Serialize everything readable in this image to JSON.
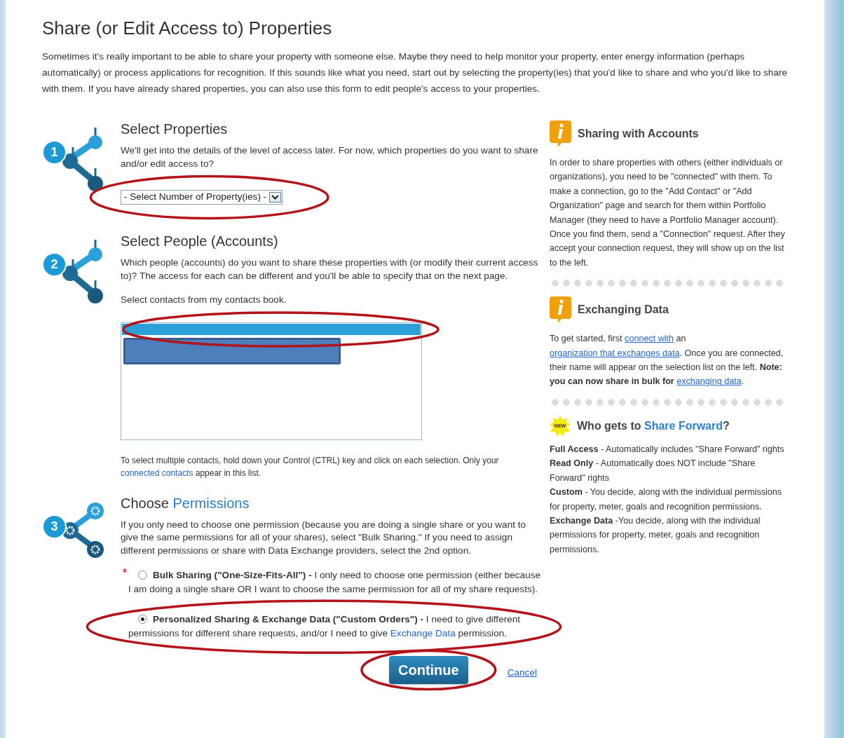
{
  "title": "Share (or Edit Access to) Properties",
  "intro": "Sometimes it's really important to be able to share your property with someone else. Maybe they need to help monitor your property, enter energy information (perhaps automatically) or process applications for recognition. If this sounds like what you need, start out by selecting the property(ies) that you'd like to share and who you'd like to share with them. If you have already shared properties, you can also use this form to edit people's access to your properties.",
  "steps": [
    {
      "kind": "dropdown",
      "number": "1",
      "title": [
        {
          "text": "Select Properties",
          "kind": "text"
        }
      ],
      "description": "We'll get into the details of the level of access later. For now, which properties do you want to share and/or edit access to?",
      "dropdown": {
        "value": "- Select Number of Property(ies) -",
        "circled": true
      }
    },
    {
      "kind": "list",
      "number": "2",
      "title": [
        {
          "text": "Select People (Accounts)",
          "kind": "text"
        }
      ],
      "description": "Which people (accounts) do you want to share these properties with (or modify their current access to)? The access for each can be different and you'll be able to specify that on the next page.",
      "list_label": "Select contacts from my contacts book.",
      "rows": [
        {
          "selected": true,
          "redacted": false,
          "circled": true
        },
        {
          "selected": false,
          "redacted": true,
          "circled": false
        }
      ],
      "note": [
        {
          "text": "To select multiple contacts, hold down your Control (CTRL) key and click on each selection. Only your ",
          "kind": "text"
        },
        {
          "text": "connected contacts",
          "kind": "link"
        },
        {
          "text": " appear in this list.",
          "kind": "text"
        }
      ]
    },
    {
      "kind": "options",
      "number": "3",
      "title": [
        {
          "text": "Choose ",
          "kind": "text"
        },
        {
          "text": "Permissions",
          "kind": "accent"
        }
      ],
      "description": "If you only need to choose one permission (because you are doing a single share or you want to give the same permissions for all of your shares), select \"Bulk Sharing.\" If you need to assign different permissions or share with Data Exchange providers, select the 2nd option.",
      "options": [
        {
          "selected": false,
          "required": true,
          "circled": false,
          "text": [
            {
              "text": "Bulk Sharing (\"One-Size-Fits-All\") -",
              "kind": "bold"
            },
            {
              "text": " I only need to choose one permission (either because I am doing a single share OR I want to choose the same permission for all of my share requests).",
              "kind": "text"
            }
          ]
        },
        {
          "selected": true,
          "required": false,
          "circled": true,
          "text": [
            {
              "text": "Personalized Sharing & Exchange Data (\"Custom Orders\") -",
              "kind": "bold"
            },
            {
              "text": " I need to give different permissions for different share requests, and/or I need to give ",
              "kind": "text"
            },
            {
              "text": "Exchange Data",
              "kind": "link"
            },
            {
              "text": " permission.",
              "kind": "text"
            }
          ]
        }
      ]
    }
  ],
  "actions": {
    "continue": {
      "label": "Continue",
      "circled": true
    },
    "cancel": "Cancel"
  },
  "sidebar": [
    {
      "kind": "info",
      "title": [
        {
          "text": "Sharing with Accounts",
          "kind": "text"
        }
      ],
      "paragraphs": [
        [
          {
            "text": "In order to share properties with others (either individuals or organizations), you need to be \"connected\" with them. To make a connection, go to the \"Add Contact\" or \"Add Organization\" page and search for them within Portfolio Manager (they need to have a Portfolio Manager account). Once you find them, send a \"Connection\" request. After they accept your connection request, they will show up on the list to the left.",
            "kind": "text"
          }
        ]
      ]
    },
    {
      "kind": "info",
      "title": [
        {
          "text": "Exchanging Data",
          "kind": "text"
        }
      ],
      "paragraphs": [
        [
          {
            "text": "To get started, first ",
            "kind": "text"
          },
          {
            "text": "connect with",
            "kind": "ulink"
          },
          {
            "text": " an ",
            "kind": "text"
          },
          {
            "text": "organization that exchanges data",
            "kind": "ulink"
          },
          {
            "text": ". Once you are connected, their name will appear on the selection list on the left. ",
            "kind": "text"
          },
          {
            "text": "Note: you can now share in bulk for ",
            "kind": "bold"
          },
          {
            "text": "exchanging data",
            "kind": "ulink"
          },
          {
            "text": ".",
            "kind": "text"
          }
        ]
      ]
    },
    {
      "kind": "new",
      "badge": "NEW",
      "title": [
        {
          "text": "Who gets to ",
          "kind": "text"
        },
        {
          "text": "Share Forward",
          "kind": "accent"
        },
        {
          "text": "?",
          "kind": "text"
        }
      ],
      "paragraphs": [
        [
          {
            "text": "Full Access",
            "kind": "bold"
          },
          {
            "text": " - Automatically includes \"Share Forward\" rights",
            "kind": "text"
          }
        ],
        [
          {
            "text": "Read Only",
            "kind": "bold"
          },
          {
            "text": " - Automatically does NOT include \"Share Forward\" rights",
            "kind": "text"
          }
        ],
        [
          {
            "text": "Custom",
            "kind": "bold"
          },
          {
            "text": " - You decide, along with the individual permissions for property, meter, goals and recognition permissions.",
            "kind": "text"
          }
        ],
        [
          {
            "text": "Exchange Data",
            "kind": "bold"
          },
          {
            "text": " -You decide, along with the individual permissions for property, meter, goals and recognition permissions.",
            "kind": "text"
          }
        ]
      ]
    }
  ]
}
